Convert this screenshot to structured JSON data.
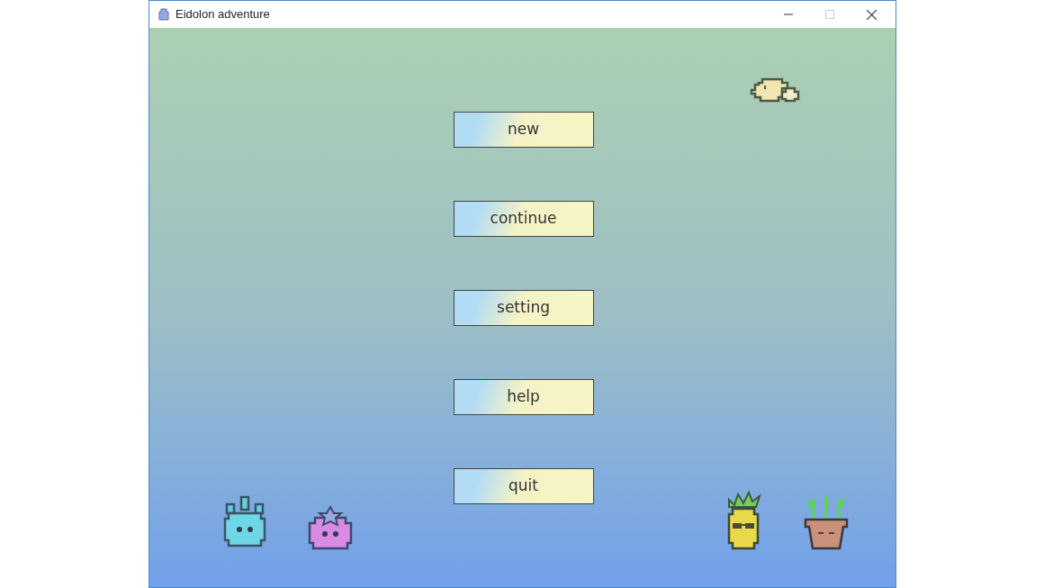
{
  "window": {
    "title": "Eidolon adventure"
  },
  "menu": [
    {
      "label": "new"
    },
    {
      "label": "continue"
    },
    {
      "label": "setting"
    },
    {
      "label": "help"
    },
    {
      "label": "quit"
    }
  ]
}
